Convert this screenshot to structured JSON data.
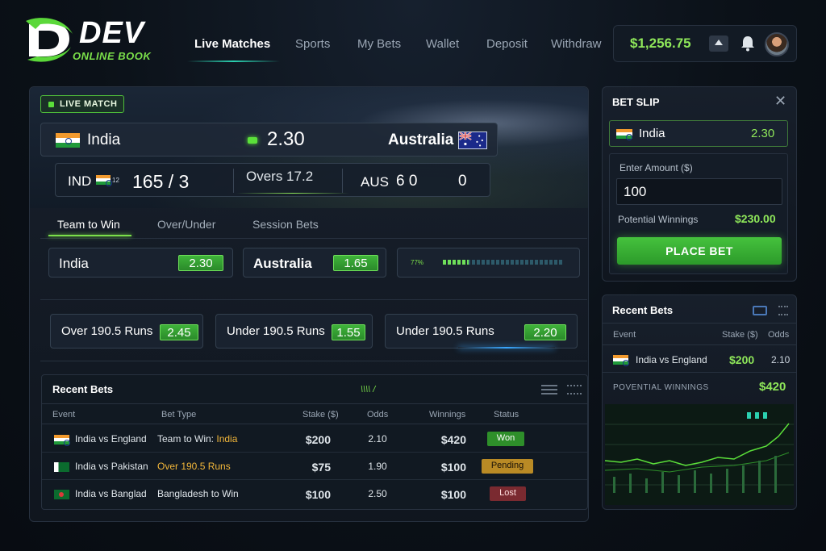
{
  "brand": {
    "name": "DEV",
    "sub": "ONLINE BOOK",
    "accent": "#7be04a"
  },
  "nav": {
    "live": "Live Matches",
    "sports": "Sports",
    "mybets": "My Bets",
    "wallet": "Wallet",
    "deposit": "Deposit",
    "withdraw": "Withdraw"
  },
  "header": {
    "balance": "$1,256.75"
  },
  "match": {
    "badge": "LIVE MATCH",
    "team1": "India",
    "team2": "Australia",
    "odds": "2.30",
    "score1_code": "IND",
    "score1_suffix": "12",
    "score1": "165 / 3",
    "overs": "Overs 17.2",
    "score2_code": "AUS",
    "score2_runs": "6 0",
    "score2_wkts": "0"
  },
  "tabs": {
    "win": "Team to Win",
    "ou": "Over/Under",
    "session": "Session Bets"
  },
  "options": {
    "india": {
      "label": "India",
      "odds": "2.30"
    },
    "aus": {
      "label": "Australia",
      "odds": "1.65"
    },
    "graph_pct": "77%",
    "graph_fill": 0.21
  },
  "overunder": [
    {
      "label": "Over 190.5 Runs",
      "odds": "2.45"
    },
    {
      "label": "Under 190.5 Runs",
      "odds": "1.55"
    },
    {
      "label": "Under 190.5 Runs",
      "odds": "2.20"
    }
  ],
  "recent": {
    "title": "Recent Bets",
    "spark": "\\\\\\\\ /",
    "headers": {
      "event": "Event",
      "type": "Bet Type",
      "stake": "Stake ($)",
      "odds": "Odds",
      "win": "Winnings",
      "status": "Status"
    },
    "rows": [
      {
        "event": "India vs England",
        "type_prefix": "Team to Win: ",
        "type_hl": "India",
        "stake": "$200",
        "odds": "2.10",
        "win": "$420",
        "status": "Won"
      },
      {
        "event": "India vs Pakistan",
        "type_prefix": "",
        "type_hl": "Over 190.5 Runs",
        "stake": "$75",
        "odds": "1.90",
        "win": "$100",
        "status": "Pending"
      },
      {
        "event": "India vs Banglad",
        "type_prefix": "Bangladesh to Win",
        "type_hl": "",
        "stake": "$100",
        "odds": "2.50",
        "win": "$100",
        "status": "Lost"
      }
    ]
  },
  "slip": {
    "title": "BET SLIP",
    "close": "✕",
    "selection": "India",
    "selection_odds": "2.30",
    "amount_label": "Enter Amount ($)",
    "amount": "100",
    "pw_label": "Potential Winnings",
    "pw_value": "$230.00",
    "place": "PLACE BET"
  },
  "rbets": {
    "title": "Recent Bets",
    "th_event": "Event",
    "th_stake": "Stake ($)",
    "th_odds": "Odds",
    "row_event": "India vs England",
    "row_stake": "$200",
    "row_odds": "2.10",
    "pw_label": "POVENTIAL WINNINGS",
    "pw_value": "$420"
  }
}
